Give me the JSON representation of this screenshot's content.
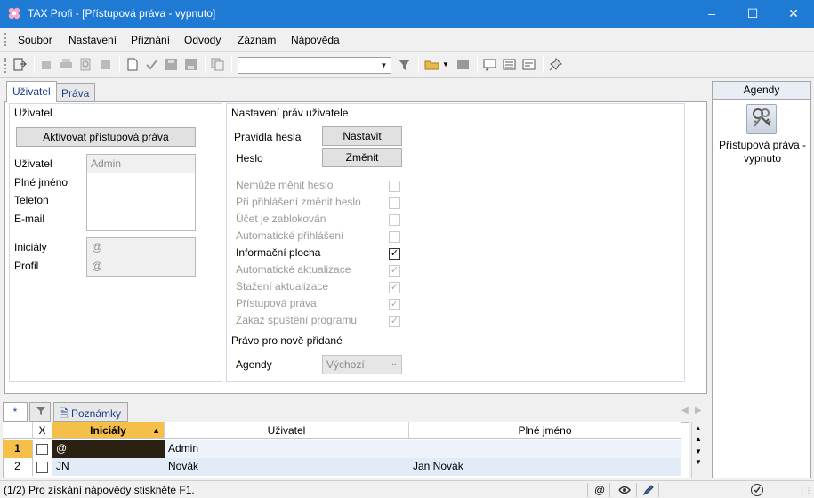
{
  "titlebar": {
    "title": "TAX Profi - [Přístupová práva - vypnuto]"
  },
  "menu": [
    "Soubor",
    "Nastavení",
    "Přiznání",
    "Odvody",
    "Záznam",
    "Nápověda"
  ],
  "tabs": [
    "Uživatel",
    "Práva"
  ],
  "user_section": {
    "title": "Uživatel",
    "activate_button": "Aktivovat přístupová práva",
    "user_label": "Uživatel",
    "user_value": "Admin",
    "fullname_label": "Plné jméno",
    "phone_label": "Telefon",
    "email_label": "E-mail",
    "initials_label": "Iniciály",
    "initials_value": "@",
    "profile_label": "Profil",
    "profile_value": "@"
  },
  "rights_section": {
    "title": "Nastavení práv uživatele",
    "password_rules_label": "Pravidla hesla",
    "set_button": "Nastavit",
    "password_label": "Heslo",
    "change_button": "Změnit",
    "options": [
      {
        "label": "Nemůže měnit heslo",
        "checked": false,
        "enabled": false
      },
      {
        "label": "Při přihlášení změnit heslo",
        "checked": false,
        "enabled": false
      },
      {
        "label": "Účet je zablokován",
        "checked": false,
        "enabled": false
      },
      {
        "label": "Automatické přihlášení",
        "checked": false,
        "enabled": false
      },
      {
        "label": "Informační plocha",
        "checked": true,
        "enabled": true
      },
      {
        "label": "Automatické aktualizace",
        "checked": true,
        "enabled": false
      },
      {
        "label": "Stažení aktualizace",
        "checked": true,
        "enabled": false
      },
      {
        "label": "Přístupová práva",
        "checked": true,
        "enabled": false
      },
      {
        "label": "Zákaz spuštění programu",
        "checked": true,
        "enabled": false
      }
    ],
    "new_rights_title": "Právo pro nově přidané",
    "agendas_label": "Agendy",
    "agendas_value": "Výchozí"
  },
  "side": {
    "header": "Agendy",
    "item_label": "Přístupová práva - vypnuto"
  },
  "grid": {
    "tabs": {
      "star": "*",
      "notes": "Poznámky"
    },
    "columns": {
      "x": "X",
      "initials": "Iniciály",
      "user": "Uživatel",
      "fullname": "Plné jméno"
    },
    "rows": [
      {
        "num": "1",
        "initials": "@",
        "user": "Admin",
        "fullname": ""
      },
      {
        "num": "2",
        "initials": "JN",
        "user": "Novák",
        "fullname": "Jan Novák"
      }
    ]
  },
  "status": {
    "text": "(1/2)  Pro získání nápovědy stiskněte F1.",
    "at": "@"
  },
  "colors": {
    "titlebar": "#1f7ad4",
    "selected_row": "#2b2112",
    "header_highlight": "#f5c04a"
  }
}
